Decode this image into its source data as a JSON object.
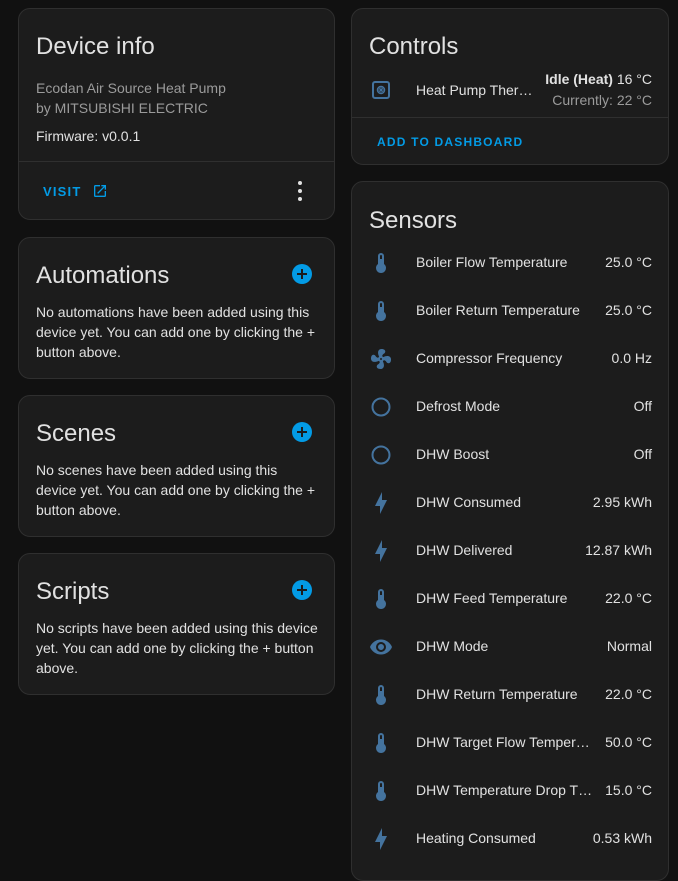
{
  "device_info": {
    "title": "Device info",
    "model": "Ecodan Air Source Heat Pump",
    "manufacturer": "by MITSUBISHI ELECTRIC",
    "firmware": "Firmware: v0.0.1",
    "visit_label": "VISIT"
  },
  "automations": {
    "title": "Automations",
    "empty_text": "No automations have been added using this device yet. You can add one by clicking the + button above."
  },
  "scenes": {
    "title": "Scenes",
    "empty_text": "No scenes have been added using this device yet. You can add one by clicking the + button above."
  },
  "scripts": {
    "title": "Scripts",
    "empty_text": "No scripts have been added using this device yet. You can add one by clicking the + button above."
  },
  "controls": {
    "title": "Controls",
    "entity_name": "Heat Pump Thermostat",
    "state": "Idle (Heat)",
    "target": "16 °C",
    "current": "Currently: 22 °C",
    "add_label": "ADD TO DASHBOARD"
  },
  "sensors": {
    "title": "Sensors",
    "items": [
      {
        "icon": "thermometer-icon",
        "name": "Boiler Flow Temperature",
        "value": "25.0 °C"
      },
      {
        "icon": "thermometer-icon",
        "name": "Boiler Return Temperature",
        "value": "25.0 °C"
      },
      {
        "icon": "fan-icon",
        "name": "Compressor Frequency",
        "value": "0.0 Hz"
      },
      {
        "icon": "circle-outline-icon",
        "name": "Defrost Mode",
        "value": "Off"
      },
      {
        "icon": "circle-outline-icon",
        "name": "DHW Boost",
        "value": "Off"
      },
      {
        "icon": "lightning-bolt-icon",
        "name": "DHW Consumed",
        "value": "2.95 kWh"
      },
      {
        "icon": "lightning-bolt-icon",
        "name": "DHW Delivered",
        "value": "12.87 kWh"
      },
      {
        "icon": "thermometer-icon",
        "name": "DHW Feed Temperature",
        "value": "22.0 °C"
      },
      {
        "icon": "eye-icon",
        "name": "DHW Mode",
        "value": "Normal"
      },
      {
        "icon": "thermometer-icon",
        "name": "DHW Return Temperature",
        "value": "22.0 °C"
      },
      {
        "icon": "thermometer-icon",
        "name": "DHW Target Flow Temperature",
        "value": "50.0 °C"
      },
      {
        "icon": "thermometer-icon",
        "name": "DHW Temperature Drop Threshold",
        "value": "15.0 °C"
      },
      {
        "icon": "lightning-bolt-icon",
        "name": "Heating Consumed",
        "value": "0.53 kWh"
      }
    ]
  },
  "colors": {
    "accent": "#039be5",
    "icon": "#44739e",
    "card": "#1c1c1c",
    "background": "#111111"
  }
}
